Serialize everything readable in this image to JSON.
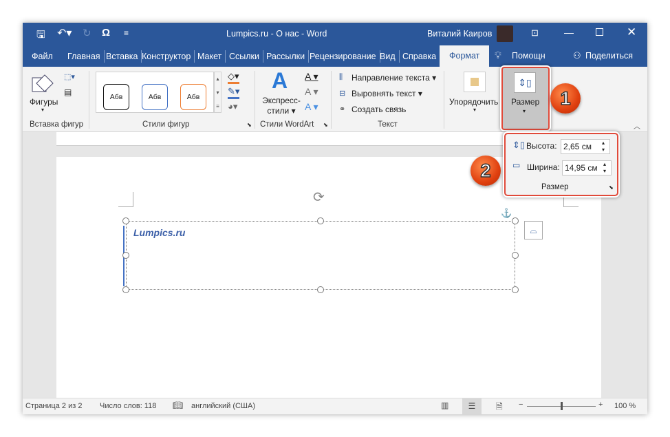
{
  "title_bar": {
    "doc_title": "Lumpics.ru - О нас  -  Word",
    "user": "Виталий Каиров"
  },
  "tabs": [
    "Файл",
    "Главная",
    "Вставка",
    "Конструктор",
    "Макет",
    "Ссылки",
    "Рассылки",
    "Рецензирование",
    "Вид",
    "Справка",
    "Формат"
  ],
  "tell_me": "Помощн",
  "share": "Поделиться",
  "ribbon": {
    "insert_shapes": {
      "shapes_label": "Фигуры",
      "group": "Вставка фигур"
    },
    "shape_styles": {
      "samples": [
        "Абв",
        "Абв",
        "Абв"
      ],
      "group": "Стили фигур"
    },
    "wordart": {
      "quick_styles_line1": "Экспресс-",
      "quick_styles_line2": "стили",
      "group": "Стили WordArt"
    },
    "text": {
      "direction": "Направление текста",
      "align": "Выровнять текст",
      "link": "Создать связь",
      "group": "Текст"
    },
    "arrange": "Упорядочить",
    "size": "Размер"
  },
  "size_panel": {
    "height_label": "Высота:",
    "height_value": "2,65 см",
    "width_label": "Ширина:",
    "width_value": "14,95 см",
    "group": "Размер"
  },
  "callouts": [
    "1",
    "2"
  ],
  "document": {
    "textbox_text": "Lumpics.ru"
  },
  "status": {
    "page": "Страница 2 из 2",
    "words": "Число слов: 118",
    "language": "английский (США)",
    "zoom": "100 %",
    "zoom_percent": 100
  }
}
